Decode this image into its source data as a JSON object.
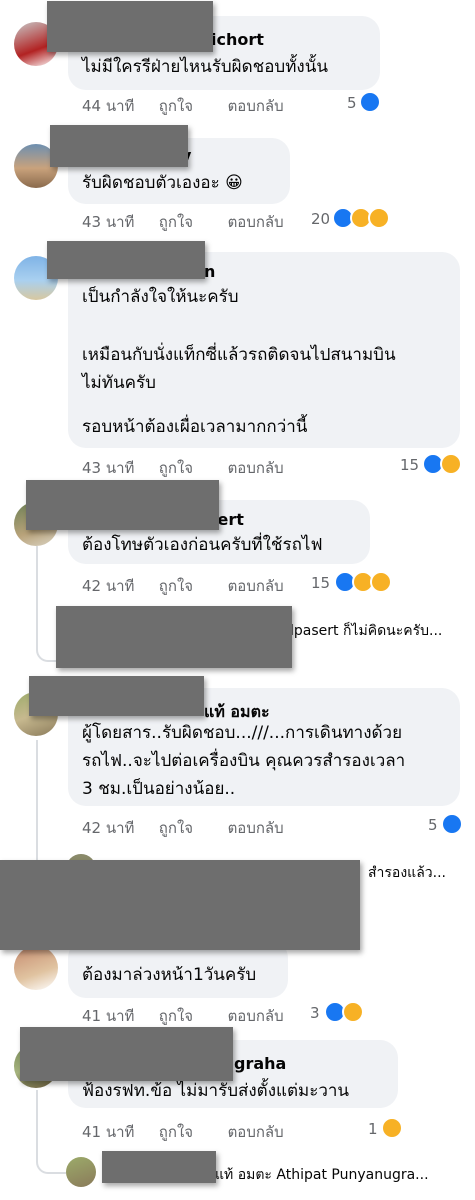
{
  "labels": {
    "like": "ถูกใจ",
    "reply": "ตอบกลับ"
  },
  "comments": [
    {
      "name": "ichort",
      "lines": [
        "ไม่มีใครรีฝ่ายไหนรับผิดชอบทั้งนั้น"
      ],
      "time": "44 นาที",
      "reaction_count": "5",
      "reactions": [
        "like-icon"
      ]
    },
    {
      "name": "y",
      "lines": [
        "รับผิดชอบตัวเองอะ 😀"
      ],
      "time": "43 นาที",
      "reaction_count": "20",
      "reactions": [
        "like-icon",
        "haha-icon",
        "care-icon"
      ]
    },
    {
      "name": "n",
      "lines": [
        "เป็นกำลังใจให้นะครับ",
        "",
        "เหมือนกับนั่งแท็กซี่แล้วรถติดจนไปสนามบิน",
        "ไม่ทันครับ",
        "",
        "รอบหน้าต้องเผื่อเวลามากกว่านี้"
      ],
      "time": "43 นาที",
      "reaction_count": "15",
      "reactions": [
        "like-icon",
        "care-icon"
      ]
    },
    {
      "name": "sert",
      "lines": [
        "ต้องโทษตัวเองก่อนครับที่ใช้รถไฟ"
      ],
      "time": "42 นาที",
      "reaction_count": "15",
      "reactions": [
        "like-icon",
        "haha-icon",
        "care-icon"
      ]
    },
    {
      "name": "แท้ อมตะ",
      "lines": [
        "ผู้โดยสาร..รับผิดชอบ...///...การเดินทางด้วย",
        "รถไฟ..จะไปต่อเครื่องบิน  คุณควรสำรองเวลา",
        "3 ชม.เป็นอย่างน้อย.."
      ],
      "time": "42 นาที",
      "reaction_count": "5",
      "reactions": [
        "like-icon"
      ]
    },
    {
      "name": "",
      "lines": [
        "ต้องมาล่วงหน้า1วันครับ"
      ],
      "time": "41 นาที",
      "reaction_count": "3",
      "reactions": [
        "like-icon",
        "haha-icon"
      ]
    },
    {
      "name": "graha",
      "lines": [
        "ฟ้องรฟท.ข้อ ไม่มารับส่งตั้งแต่มะวาน"
      ],
      "time": "41 นาที",
      "reaction_count": "1",
      "reactions": [
        "haha-icon"
      ]
    }
  ],
  "reply_previews": [
    {
      "text": "lpasert ก็ไม่คิดนะครับ..."
    },
    {
      "text": "สำรองแล้ว..."
    },
    {
      "text": "แท้ อมตะ Athipat Punyanugra..."
    }
  ],
  "colors": {
    "bubble": "#f0f2f5",
    "meta": "#65676b",
    "like": "#1877f2",
    "haha": "#f7b125",
    "redaction": "#6e6e6e"
  }
}
